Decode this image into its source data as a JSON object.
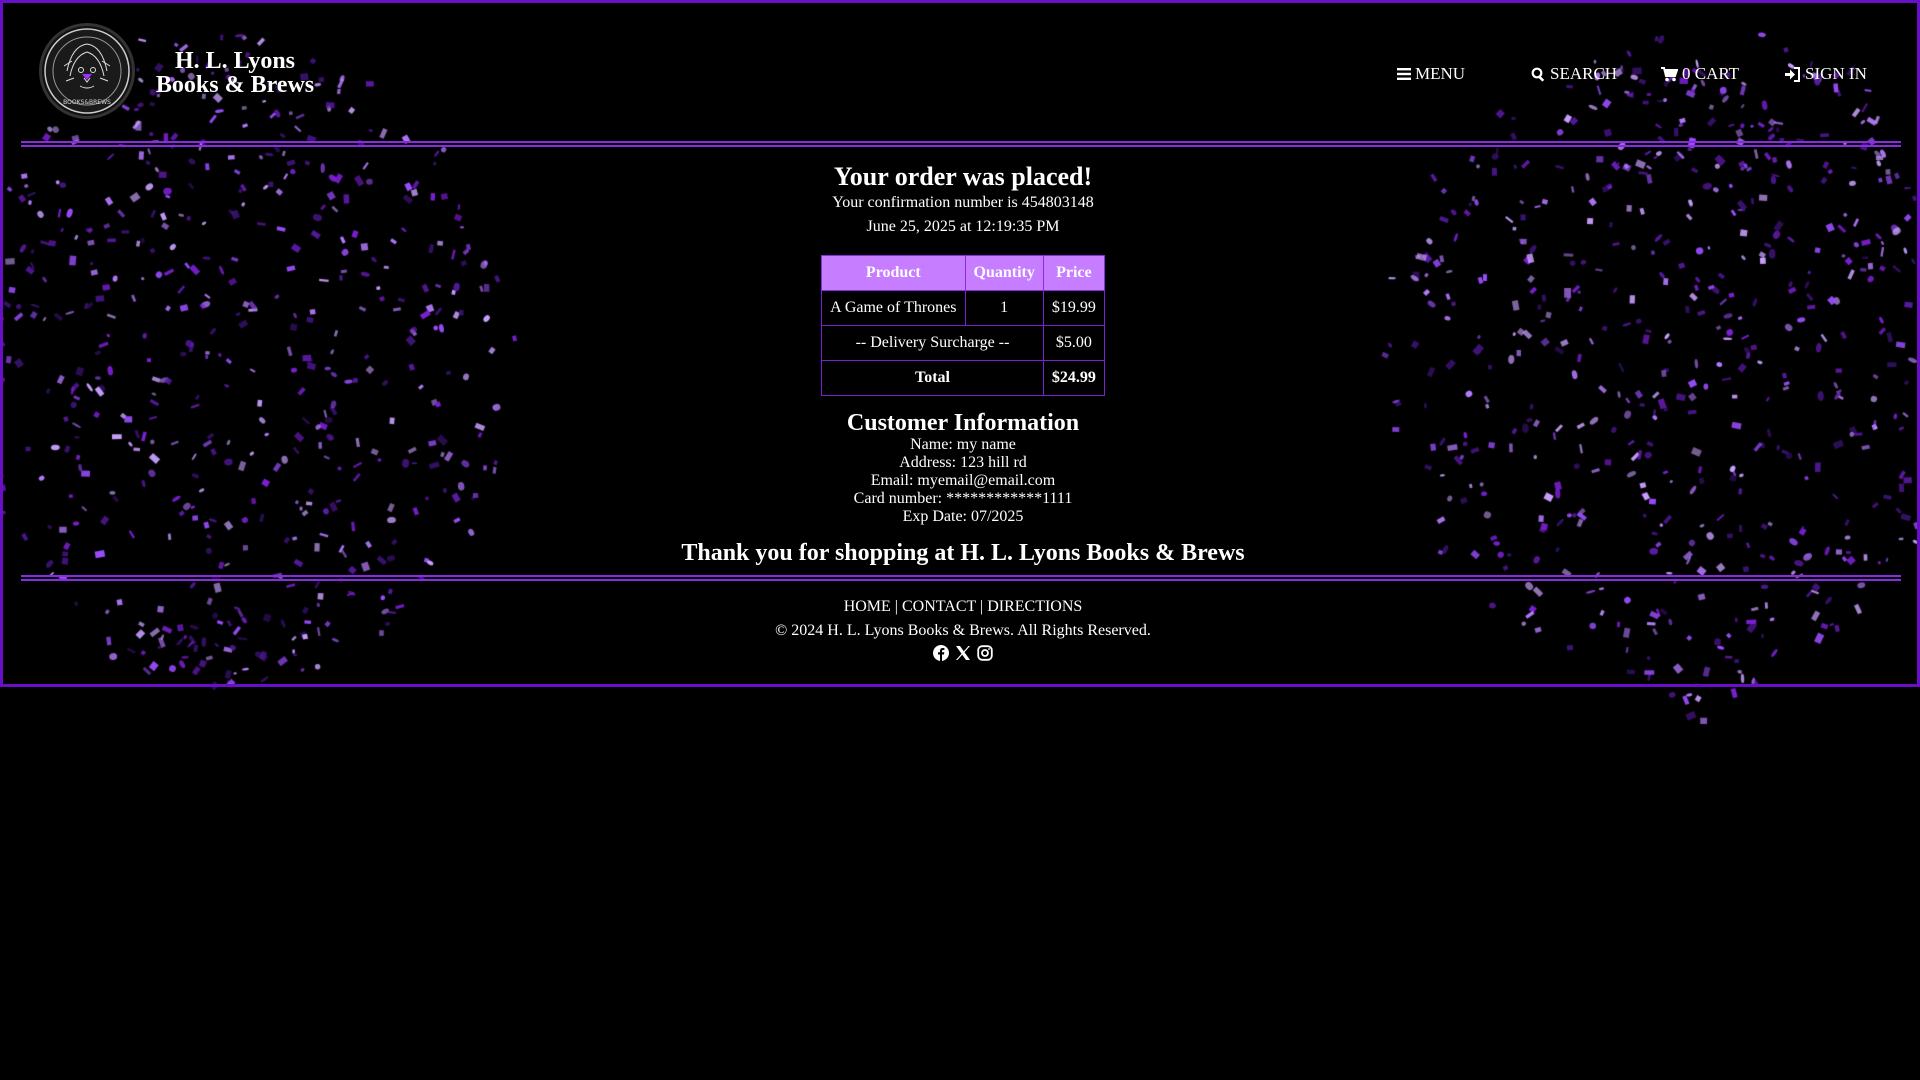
{
  "brand": {
    "name_line1": "H. L. Lyons",
    "name_line2": "Books & Brews",
    "logo_text": "H.L.LYONS BOOKS & BREWS"
  },
  "nav": [
    {
      "icon": "menu-icon",
      "label": "MENU"
    },
    {
      "icon": "search-icon",
      "label": "SEARCH"
    },
    {
      "icon": "cart-icon",
      "label": "0 CART"
    },
    {
      "icon": "sign-in-icon",
      "label": "SIGN IN"
    }
  ],
  "order": {
    "title": "Your order was placed!",
    "confirmation": "Your confirmation number is 454803148",
    "timestamp": "June 25, 2025 at 12:19:35 PM",
    "table": {
      "headers": [
        "Product",
        "Quantity",
        "Price"
      ],
      "rows": [
        {
          "product": "A Game of Thrones",
          "quantity": "1",
          "price": "$19.99"
        }
      ],
      "surcharge_label": "-- Delivery Surcharge --",
      "surcharge_price": "$5.00",
      "total_label": "Total",
      "total_price": "$24.99"
    }
  },
  "customer": {
    "title": "Customer Information",
    "name": "Name: my name",
    "address": "Address: 123 hill rd",
    "email": "Email: myemail@email.com",
    "card": "Card number: ************1111",
    "exp": "Exp Date: 07/2025"
  },
  "thanks": "Thank you for shopping at H. L. Lyons Books & Brews",
  "footer": {
    "links": [
      "HOME",
      "CONTACT",
      "DIRECTIONS"
    ],
    "separator": " | ",
    "copyright": "© 2024 H. L. Lyons Books & Brews. All Rights Reserved.",
    "social": [
      "facebook-icon",
      "x-icon",
      "instagram-icon"
    ]
  },
  "colors": {
    "accent": "#8a2be2",
    "frame": "#6a0fc8",
    "table_header": "#c77dff",
    "background": "#000000"
  }
}
